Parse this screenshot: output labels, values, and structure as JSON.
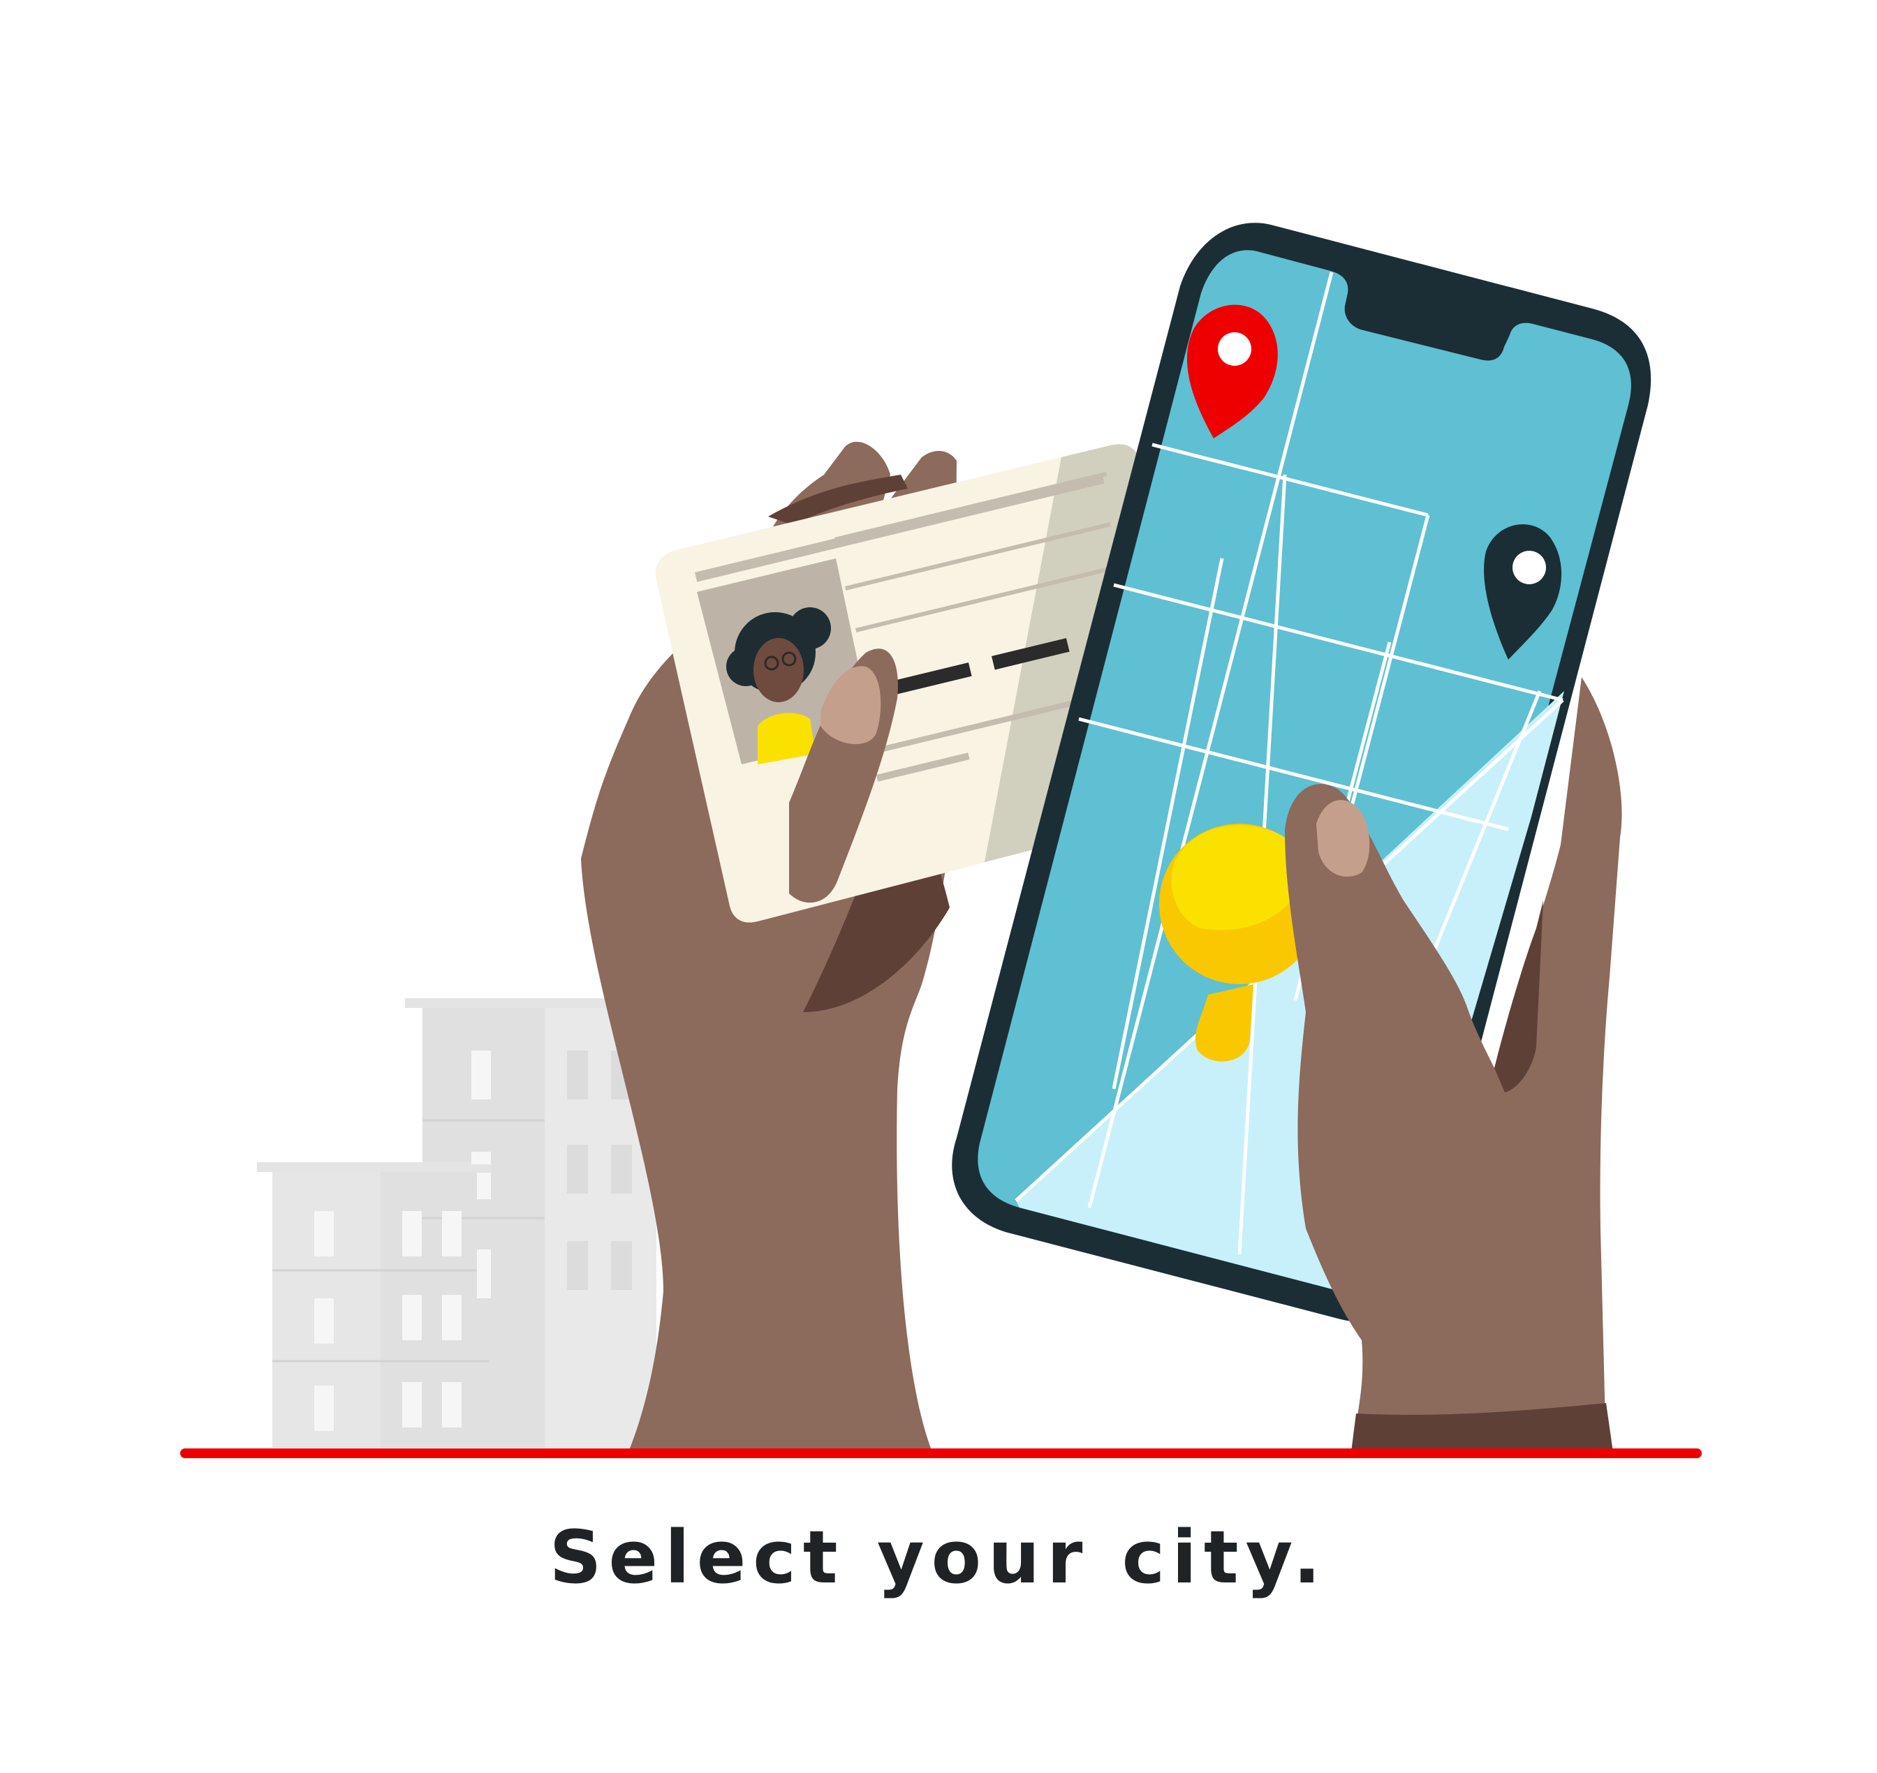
{
  "caption": "Select your city.",
  "colors": {
    "background": "#ffffff",
    "ground_line": "#ee0000",
    "skin": "#8c6a5c",
    "skin_shadow": "#5e4037",
    "nail": "#c4a08c",
    "phone_body": "#1b2e36",
    "map_water": "#5ec0d2",
    "map_light": "#c8f0fb",
    "pin_red": "#ee0000",
    "pin_dark": "#1b2e36",
    "pin_yellow": "#fae100",
    "card": "#f9f3e4",
    "building": "#e0e0e0",
    "caption_text": "#1f2326"
  },
  "icons": [
    "location-pin-icon",
    "id-card-icon",
    "smartphone-icon",
    "building-icon"
  ]
}
